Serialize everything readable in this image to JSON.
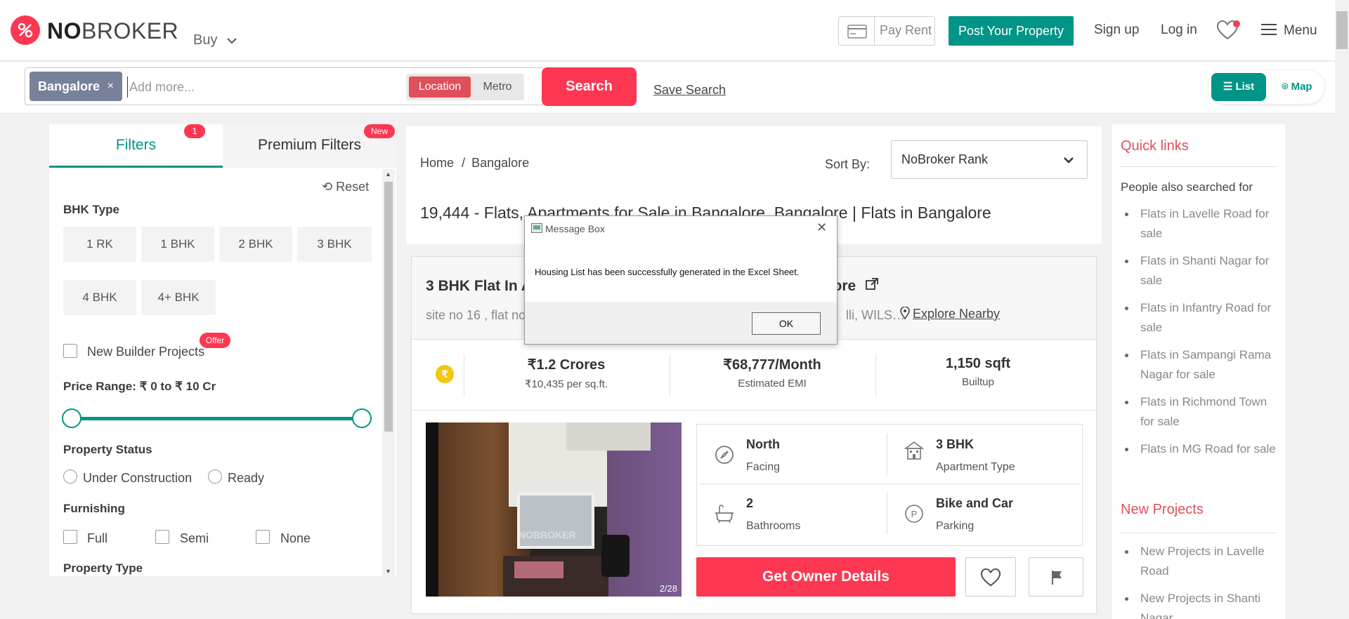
{
  "header": {
    "logo_bold": "NO",
    "logo_rest": "BROKER",
    "buy": "Buy",
    "pay_rent": "Pay Rent",
    "post_property": "Post Your Property",
    "sign_up": "Sign up",
    "log_in": "Log in",
    "menu": "Menu"
  },
  "search": {
    "city": "Bangalore",
    "chip_close": "×",
    "placeholder": "Add more...",
    "location": "Location",
    "metro": "Metro",
    "search_button": "Search",
    "save_search": "Save Search",
    "list": "List",
    "map": "Map"
  },
  "filters": {
    "tab_filters": "Filters",
    "filters_count": "1",
    "tab_premium": "Premium Filters",
    "new_badge": "New",
    "reset": "Reset",
    "bhk_type": "BHK Type",
    "bhk_options": [
      "1 RK",
      "1 BHK",
      "2 BHK",
      "3 BHK",
      "4 BHK",
      "4+ BHK"
    ],
    "new_builder": "New Builder Projects",
    "offer_badge": "Offer",
    "price_range": "Price Range: ₹ 0 to ₹ 10 Cr",
    "property_status": "Property Status",
    "under_construction": "Under Construction",
    "ready": "Ready",
    "furnishing": "Furnishing",
    "full": "Full",
    "semi": "Semi",
    "none": "None",
    "property_type": "Property Type"
  },
  "results": {
    "breadcrumb_home": "Home",
    "breadcrumb_sep": "/",
    "breadcrumb_city": "Bangalore",
    "sort_by": "Sort By:",
    "sort_value": "NoBroker Rank",
    "title": "19,444 - Flats, Apartments for Sale in Bangalore, Bangalore | Flats in Bangalore"
  },
  "listing": {
    "title_start": "3 BHK Flat In Ap",
    "title_end": "alore",
    "address_start": "site no 16 , flat no",
    "address_end": "lli, WILS…",
    "explore_nearby": "Explore Nearby",
    "rupee": "₹",
    "price": "₹1.2 Crores",
    "price_per_sqft": "₹10,435 per sq.ft.",
    "emi": "₹68,777/Month",
    "emi_label": "Estimated EMI",
    "area": "1,150 sqft",
    "area_label": "Builtup",
    "photo_count": "2/28",
    "facing": "North",
    "facing_label": "Facing",
    "apt_type": "3 BHK",
    "apt_type_label": "Apartment Type",
    "bathrooms": "2",
    "bathrooms_label": "Bathrooms",
    "parking": "Bike and Car",
    "parking_label": "Parking",
    "owner_details": "Get Owner Details",
    "watermark": "NOBROKER"
  },
  "quick_links": {
    "title": "Quick links",
    "subtitle": "People also searched for",
    "items": [
      "Flats in Lavelle Road for sale",
      "Flats in Shanti Nagar for sale",
      "Flats in Infantry Road for sale",
      "Flats in Sampangi Rama Nagar for sale",
      "Flats in Richmond Town for sale",
      "Flats in MG Road for sale"
    ],
    "new_projects_title": "New Projects",
    "new_projects": [
      "New Projects in Lavelle Road",
      "New Projects in Shanti Nagar"
    ]
  },
  "modal": {
    "title": "Message Box",
    "close": "✕",
    "message": "Housing List has been successfully generated in the Excel Sheet.",
    "ok": "OK"
  },
  "colors": {
    "brand_red": "#fd3752",
    "brand_teal": "#009587",
    "chip_gray": "#77819a"
  }
}
